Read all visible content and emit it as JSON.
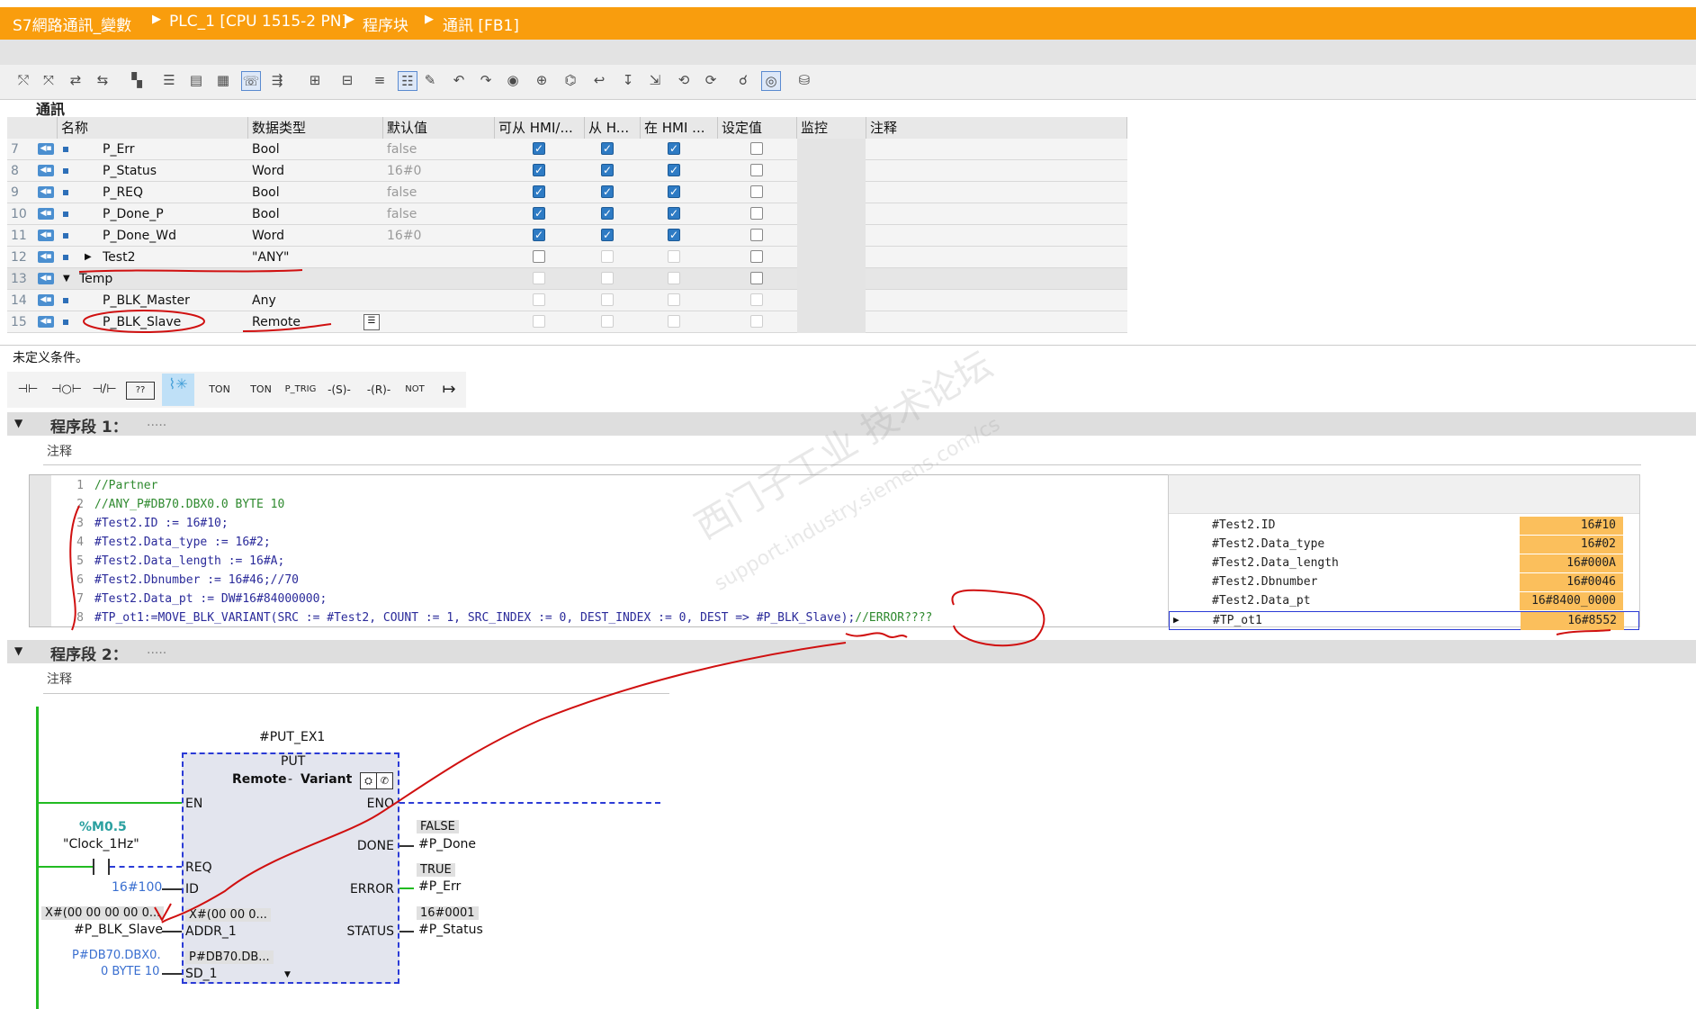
{
  "breadcrumb": [
    "S7網路通訊_變數",
    "PLC_1 [CPU 1515-2 PN]",
    "程序块",
    "通訊 [FB1]"
  ],
  "block_name": "通訊",
  "table": {
    "headers": [
      "名称",
      "数据类型",
      "默认值",
      "可从 HMI/...",
      "从 H...",
      "在 HMI ...",
      "设定值",
      "监控",
      "注释"
    ],
    "rows": [
      {
        "num": "7",
        "name": "P_Err",
        "type": "Bool",
        "default": "false",
        "hmi1": true,
        "hmi2": true,
        "hmi3": true,
        "setpoint": false
      },
      {
        "num": "8",
        "name": "P_Status",
        "type": "Word",
        "default": "16#0",
        "hmi1": true,
        "hmi2": true,
        "hmi3": true,
        "setpoint": false
      },
      {
        "num": "9",
        "name": "P_REQ",
        "type": "Bool",
        "default": "false",
        "hmi1": true,
        "hmi2": true,
        "hmi3": true,
        "setpoint": false
      },
      {
        "num": "10",
        "name": "P_Done_P",
        "type": "Bool",
        "default": "false",
        "hmi1": true,
        "hmi2": true,
        "hmi3": true,
        "setpoint": false
      },
      {
        "num": "11",
        "name": "P_Done_Wd",
        "type": "Word",
        "default": "16#0",
        "hmi1": true,
        "hmi2": true,
        "hmi3": true,
        "setpoint": false
      },
      {
        "num": "12",
        "name": "Test2",
        "type": "\"ANY\"",
        "default": "",
        "hmi1": false,
        "hmi2": false,
        "hmi3": false,
        "setpoint": false
      },
      {
        "num": "13",
        "name": "Temp",
        "type": "",
        "default": "",
        "hmi1": false,
        "hmi2": false,
        "hmi3": false,
        "setpoint": false
      },
      {
        "num": "14",
        "name": "P_BLK_Master",
        "type": "Any",
        "default": "",
        "hmi1": false,
        "hmi2": false,
        "hmi3": false,
        "setpoint": false
      },
      {
        "num": "15",
        "name": "P_BLK_Slave",
        "type": "Remote",
        "default": "",
        "hmi1": false,
        "hmi2": false,
        "hmi3": false,
        "setpoint": false
      }
    ]
  },
  "undefined_condition": "未定义条件。",
  "instructions": [
    "⊣⊢",
    "⊣○⊢",
    "⊣/⊢",
    "??",
    "",
    "TON",
    "TON",
    "P_TRIG",
    "-(S)-",
    "-(R)-",
    "NOT",
    "↦"
  ],
  "network1": {
    "label": "程序段 1：",
    "dots": ".....",
    "comment": "注释",
    "code": [
      {
        "n": "1",
        "text": "//Partner",
        "kind": "comment"
      },
      {
        "n": "2",
        "text": "//ANY_P#DB70.DBX0.0 BYTE 10",
        "kind": "comment"
      },
      {
        "n": "3",
        "text": "#Test2.ID := 16#10;",
        "kind": "code"
      },
      {
        "n": "4",
        "text": "#Test2.Data_type := 16#2;",
        "kind": "code"
      },
      {
        "n": "5",
        "text": "#Test2.Data_length := 16#A;",
        "kind": "code"
      },
      {
        "n": "6",
        "text": "#Test2.Dbnumber := 16#46;//70",
        "kind": "code"
      },
      {
        "n": "7",
        "text": "#Test2.Data_pt := DW#16#84000000;",
        "kind": "code"
      },
      {
        "n": "8",
        "text": "#TP_ot1:=MOVE_BLK_VARIANT(SRC := #Test2, COUNT := 1, SRC_INDEX := 0, DEST_INDEX := 0, DEST => #P_BLK_Slave);",
        "kind": "code",
        "tail": "//ERROR????"
      }
    ],
    "monitor": [
      {
        "name": "#Test2.ID",
        "value": "16#10"
      },
      {
        "name": "#Test2.Data_type",
        "value": "16#02"
      },
      {
        "name": "#Test2.Data_length",
        "value": "16#000A"
      },
      {
        "name": "#Test2.Dbnumber",
        "value": "16#0046"
      },
      {
        "name": "#Test2.Data_pt",
        "value": "16#8400_0000"
      },
      {
        "name": "#TP_ot1",
        "value": "16#8552"
      }
    ]
  },
  "network2": {
    "label": "程序段 2：",
    "dots": ".....",
    "comment": "注释",
    "instance": "#PUT_EX1",
    "block": "PUT",
    "block_sub1": "Remote",
    "block_sep": "-",
    "block_sub2": "Variant",
    "pins_left": [
      "EN",
      "REQ",
      "ID",
      "ADDR_1",
      "SD_1"
    ],
    "pins_right": [
      "ENO",
      "DONE",
      "ERROR",
      "STATUS"
    ],
    "req_addr": "%M0.5",
    "req_symbol": "\"Clock_1Hz\"",
    "id_value": "16#100",
    "addr_live": "X#(00 00 00 00 0...",
    "addr_var": "#P_BLK_Slave",
    "addr_inner": "X#(00 00 0...",
    "sd_line1": "P#DB70.DBX0.",
    "sd_line2": "0 BYTE 10",
    "sd_inner": "P#DB70.DB...",
    "done_val": "FALSE",
    "done_var": "#P_Done",
    "err_val": "TRUE",
    "err_var": "#P_Err",
    "status_val": "16#0001",
    "status_var": "#P_Status"
  },
  "watermark": {
    "cn": "西门子工业  技术论坛",
    "en": "support.industry.siemens.com/cs"
  },
  "colors": {
    "title_bar": "#f99d0d",
    "annotation": "#d01010",
    "monitor_value": "#fbbf5c",
    "fb_border": "#2b3bd6",
    "wire_green": "#22bb22"
  }
}
